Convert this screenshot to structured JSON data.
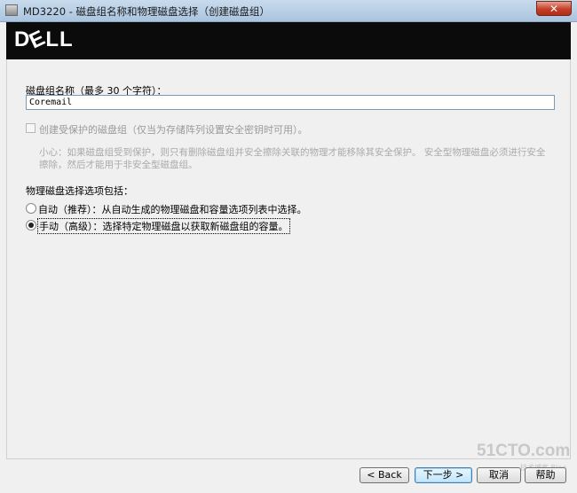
{
  "window": {
    "title": "MD3220 - 磁盘组名称和物理磁盘选择（创建磁盘组）",
    "close_glyph": "✕"
  },
  "brand": {
    "logo_left": "D",
    "logo_mid": "E",
    "logo_right": "LL"
  },
  "form": {
    "name_label": "磁盘组名称（最多 30 个字符）：",
    "name_value": "Coremail",
    "secure_checkbox_label": "创建受保护的磁盘组（仅当为存储阵列设置安全密钥时可用）。",
    "secure_checked": false,
    "secure_note": "小心：如果磁盘组受到保护，则只有删除磁盘组并安全擦除关联的物理才能移除其安全保护。 安全型物理磁盘必须进行安全擦除，然后才能用于非安全型磁盘组。",
    "selection_heading": "物理磁盘选择选项包括：",
    "options": [
      {
        "label": "自动（推荐）：从自动生成的物理磁盘和容量选项列表中选择。",
        "selected": false
      },
      {
        "label": "手动（高级）：选择特定物理磁盘以获取新磁盘组的容量。",
        "selected": true
      }
    ]
  },
  "buttons": {
    "back": "< Back",
    "next": "下一步 >",
    "cancel": "取消",
    "help": "帮助"
  },
  "watermark": {
    "main": "51CTO.com",
    "sub": "技术博客 Blog"
  },
  "colors": {
    "title_bar": "#b9d1ea",
    "banner": "#0b0b0b",
    "close_button": "#c4402a"
  }
}
